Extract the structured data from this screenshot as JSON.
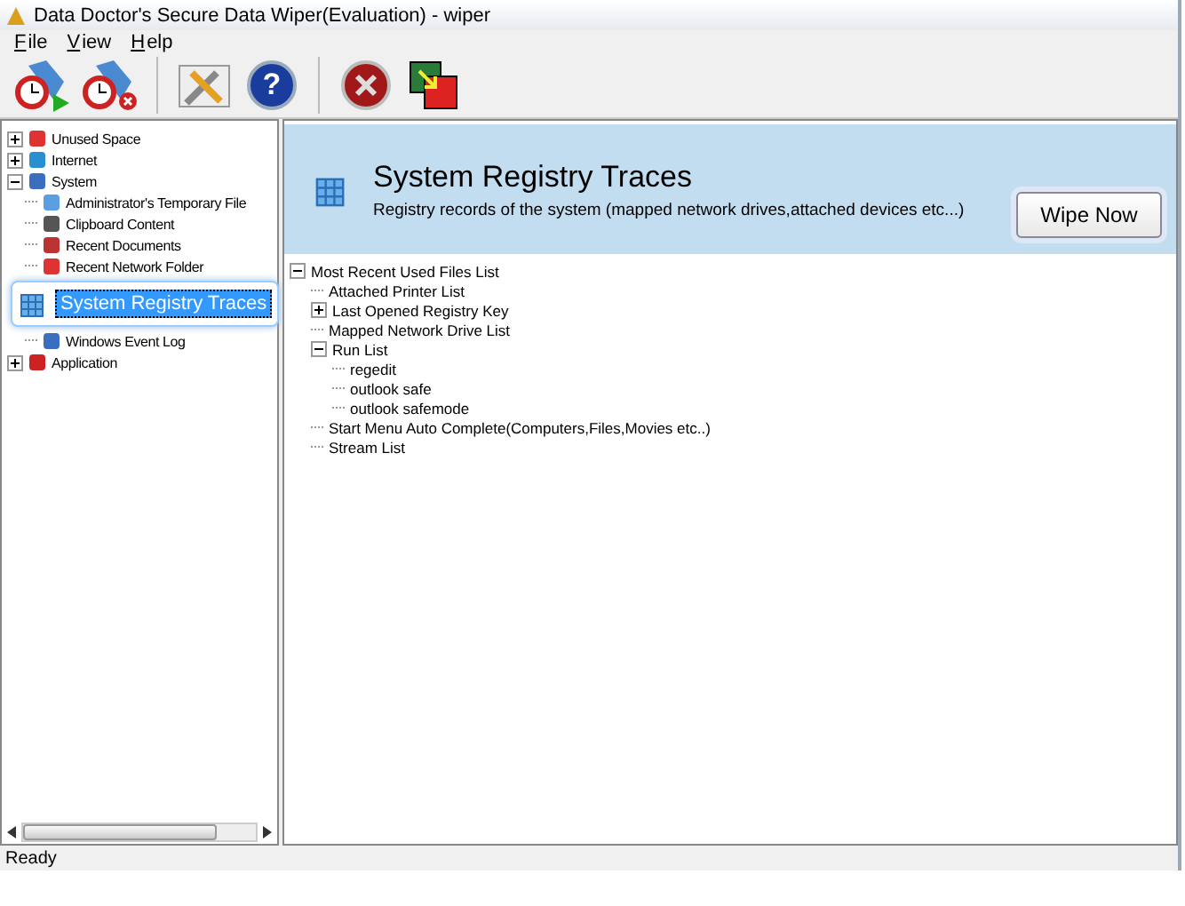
{
  "window": {
    "title": "Data Doctor's Secure Data Wiper(Evaluation) - wiper"
  },
  "menu": [
    {
      "label": "File"
    },
    {
      "label": "View"
    },
    {
      "label": "Help"
    }
  ],
  "toolbar": [
    {
      "kind": "schedule"
    },
    {
      "kind": "unschedule"
    },
    {
      "kind": "settings"
    },
    {
      "kind": "help",
      "glyph": "?"
    },
    {
      "kind": "exit"
    },
    {
      "kind": "switch"
    }
  ],
  "sidebar": {
    "items": [
      {
        "label": "Unused Space",
        "expanded": false,
        "selected": false
      },
      {
        "label": "Internet",
        "expanded": false,
        "selected": false
      },
      {
        "label": "System",
        "expanded": true,
        "selected": false,
        "children": [
          {
            "label": "Administrator's Temporary File",
            "selected": false
          },
          {
            "label": "Clipboard Content",
            "selected": false
          },
          {
            "label": "Recent Documents",
            "selected": false
          },
          {
            "label": "Recent Network Folder",
            "selected": false
          },
          {
            "label": "System Registry Traces",
            "selected": true
          },
          {
            "label": "Windows Event Log",
            "selected": false
          }
        ]
      },
      {
        "label": "Application",
        "expanded": false,
        "selected": false
      }
    ]
  },
  "header": {
    "title": "System Registry Traces",
    "subtitle": "Registry records of the system (mapped network drives,attached devices etc...)",
    "button": "Wipe Now"
  },
  "tree": [
    {
      "label": "Most Recent Used Files List",
      "expanded": true,
      "children": [
        {
          "label": "Attached Printer List"
        },
        {
          "label": "Last Opened Registry Key",
          "expanded": false
        },
        {
          "label": "Mapped Network Drive List"
        },
        {
          "label": "Run List",
          "expanded": true,
          "children": [
            {
              "label": "regedit"
            },
            {
              "label": "outlook safe"
            },
            {
              "label": "outlook safemode"
            }
          ]
        },
        {
          "label": "Start Menu Auto Complete(Computers,Files,Movies etc..)"
        },
        {
          "label": "Stream List"
        }
      ]
    }
  ],
  "status_bar": {
    "text": "Ready"
  }
}
